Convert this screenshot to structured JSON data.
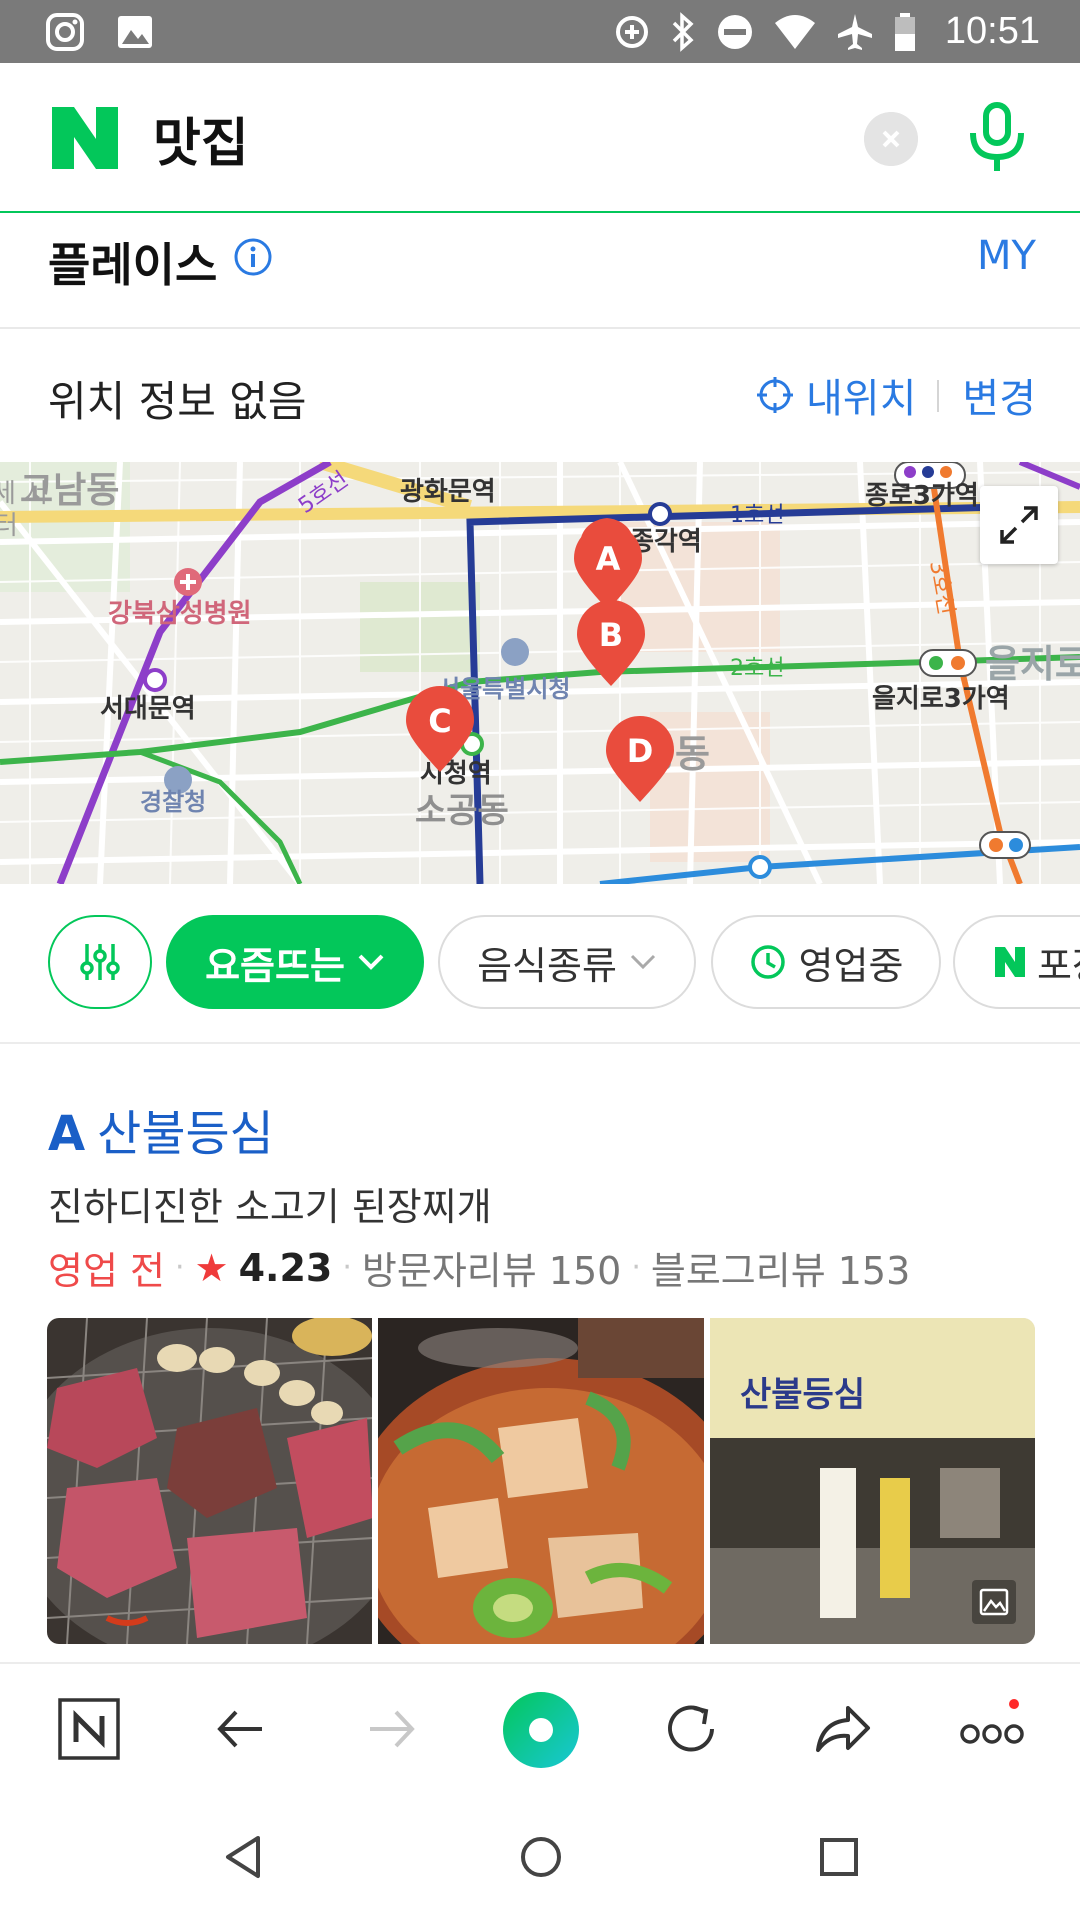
{
  "status_bar": {
    "time": "10:51",
    "left_icons": [
      "instagram-icon",
      "gallery-icon"
    ],
    "right_icons": [
      "data-saver-icon",
      "bluetooth-icon",
      "do-not-disturb-icon",
      "wifi-icon",
      "airplane-icon",
      "battery-icon"
    ]
  },
  "search": {
    "logo": "N",
    "query": "맛집"
  },
  "place_header": {
    "title": "플레이스",
    "my_label": "MY"
  },
  "location": {
    "status": "위치 정보 없음",
    "my_location_label": "내위치",
    "change_label": "변경"
  },
  "map": {
    "labels": {
      "gwanghwamun": "광화문역",
      "jonggak": "종각역",
      "jongno3ga": "종로3가역",
      "seodaemun": "서대문역",
      "gangbuk": "강북삼성병원",
      "cityhall": "서울특별시청",
      "cityhall_stn": "시청역",
      "sogong": "소공동",
      "police": "경찰청",
      "euljiro3ga": "을지로3가역",
      "euljiro_big": "을지로",
      "myeongdong": "명동",
      "gonam": "고남동",
      "line1": "1호선",
      "line2": "2호선",
      "line3": "3호선",
      "line5": "5호선",
      "center_left": "세 서",
      "center_left2": "터"
    },
    "markers": [
      "A",
      "B",
      "C",
      "D"
    ]
  },
  "filters": {
    "trending": "요즘뜨는",
    "food_type": "음식종류",
    "open_now": "영업중",
    "naver_pay": "포장"
  },
  "result": {
    "letter": "A",
    "name": "산불등심",
    "description": "진하디진한 소고기 된장찌개",
    "status": "영업 전",
    "rating": "4.23",
    "visitor_reviews": "방문자리뷰 150",
    "blog_reviews": "블로그리뷰 153",
    "sign_text": "산불등심"
  },
  "toolbar": {
    "items": [
      "naver-home-icon",
      "back-arrow-icon",
      "forward-arrow-icon",
      "green-dot-icon",
      "refresh-icon",
      "share-icon",
      "more-icon"
    ]
  }
}
